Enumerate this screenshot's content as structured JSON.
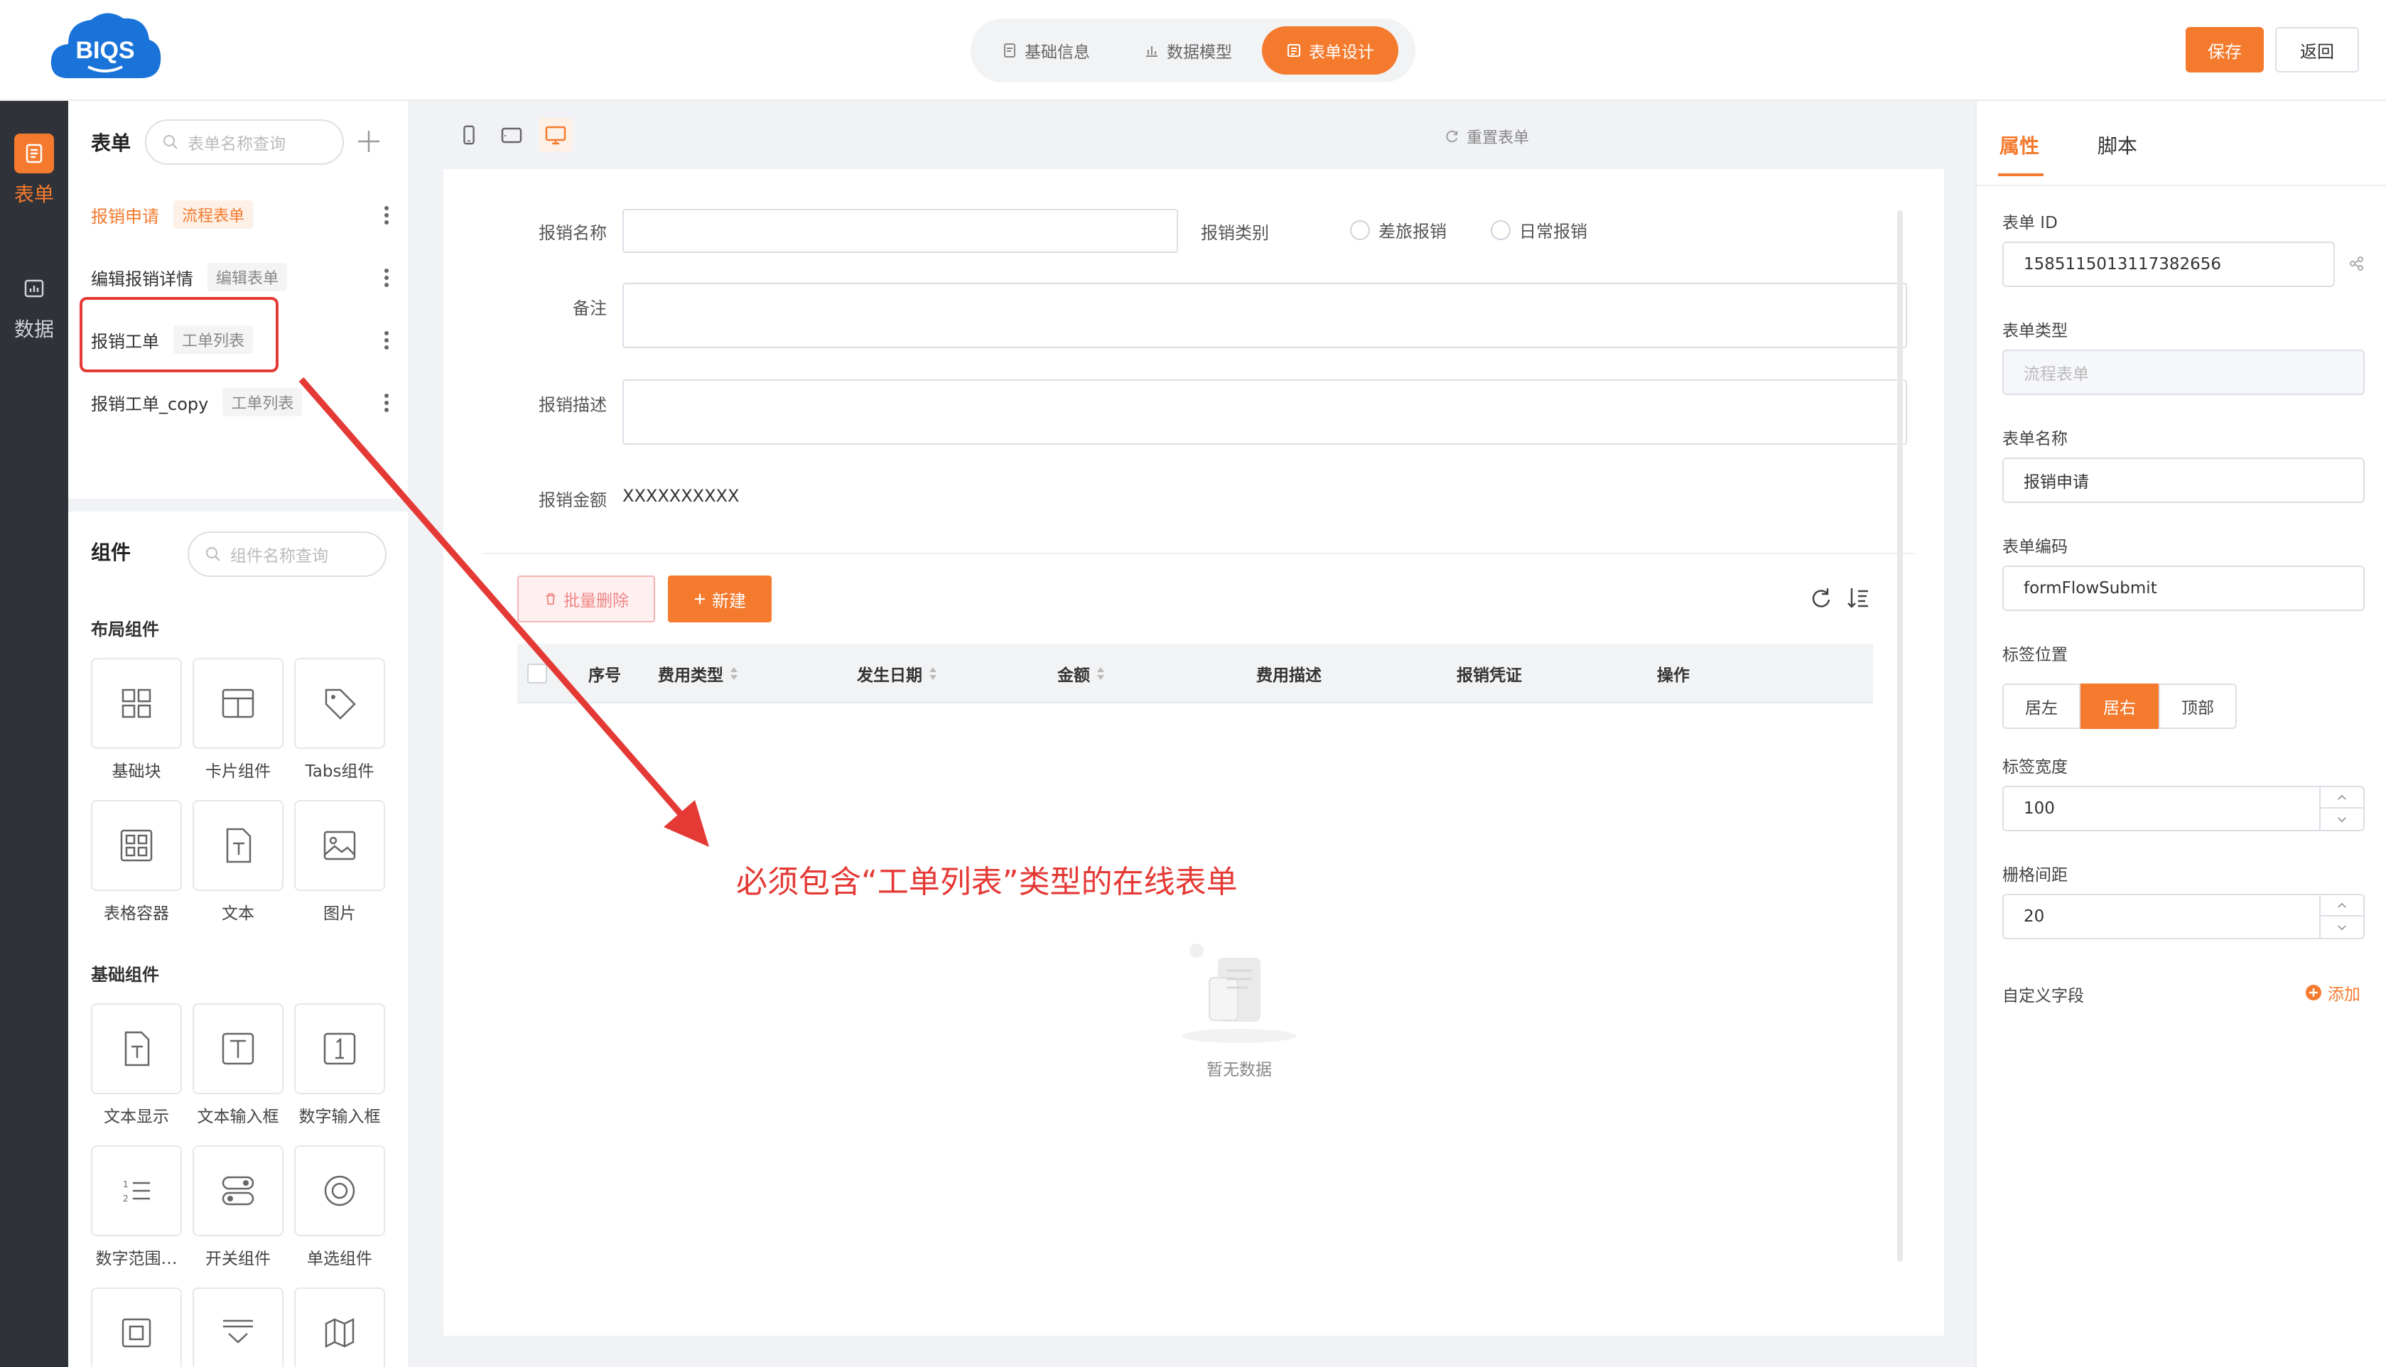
{
  "header": {
    "logo_text": "BIQS",
    "steps": [
      {
        "label": "基础信息",
        "icon": "document-icon",
        "active": false
      },
      {
        "label": "数据模型",
        "icon": "bar-chart-icon",
        "active": false
      },
      {
        "label": "表单设计",
        "icon": "form-icon",
        "active": true
      }
    ],
    "save_label": "保存",
    "back_label": "返回",
    "accent": "#f47a2e"
  },
  "rail": {
    "items": [
      {
        "label": "表单",
        "icon": "form-list-icon",
        "active": true
      },
      {
        "label": "数据",
        "icon": "data-chart-icon",
        "active": false
      }
    ]
  },
  "forms": {
    "title": "表单",
    "search_placeholder": "表单名称查询",
    "items": [
      {
        "name": "报销申请",
        "tag": "流程表单",
        "active": true
      },
      {
        "name": "编辑报销详情",
        "tag": "编辑表单",
        "active": false
      },
      {
        "name": "报销工单",
        "tag": "工单列表",
        "active": false
      },
      {
        "name": "报销工单_copy",
        "tag": "工单列表",
        "active": false
      }
    ]
  },
  "components": {
    "title": "组件",
    "search_placeholder": "组件名称查询",
    "layout_title": "布局组件",
    "layout": [
      {
        "label": "基础块",
        "icon": "grid-icon"
      },
      {
        "label": "卡片组件",
        "icon": "card-icon"
      },
      {
        "label": "Tabs组件",
        "icon": "tag-icon"
      },
      {
        "label": "表格容器",
        "icon": "table-grid-icon"
      },
      {
        "label": "文本",
        "icon": "text-file-icon"
      },
      {
        "label": "图片",
        "icon": "image-icon"
      }
    ],
    "basic_title": "基础组件",
    "basic": [
      {
        "label": "文本显示",
        "icon": "text-display-icon"
      },
      {
        "label": "文本输入框",
        "icon": "text-input-icon"
      },
      {
        "label": "数字输入框",
        "icon": "number-input-icon"
      },
      {
        "label": "数字范围…",
        "icon": "number-range-icon"
      },
      {
        "label": "开关组件",
        "icon": "switch-icon"
      },
      {
        "label": "单选组件",
        "icon": "radio-icon"
      },
      {
        "label": "",
        "icon": "checkbox-icon"
      },
      {
        "label": "",
        "icon": "select-icon"
      },
      {
        "label": "",
        "icon": "map-icon"
      }
    ]
  },
  "canvas": {
    "reset_label": "重置表单",
    "fields": {
      "name_label": "报销名称",
      "type_label": "报销类别",
      "type_options": [
        "差旅报销",
        "日常报销"
      ],
      "note_label": "备注",
      "desc_label": "报销描述",
      "amount_label": "报销金额",
      "amount_value": "XXXXXXXXXX"
    },
    "table": {
      "batch_delete_label": "批量删除",
      "new_label": "新建",
      "columns": [
        "序号",
        "费用类型",
        "发生日期",
        "金额",
        "费用描述",
        "报销凭证",
        "操作"
      ],
      "empty_text": "暂无数据"
    },
    "annotation": "必须包含“工单列表”类型的在线表单"
  },
  "props": {
    "tabs": [
      "属性",
      "脚本"
    ],
    "form_id_label": "表单 ID",
    "form_id_value": "1585115013117382656",
    "form_type_label": "表单类型",
    "form_type_value": "流程表单",
    "form_name_label": "表单名称",
    "form_name_value": "报销申请",
    "form_code_label": "表单编码",
    "form_code_value": "formFlowSubmit",
    "label_pos_label": "标签位置",
    "label_pos_options": [
      "居左",
      "居右",
      "顶部"
    ],
    "label_pos_selected": "居右",
    "label_width_label": "标签宽度",
    "label_width_value": "100",
    "grid_gap_label": "栅格间距",
    "grid_gap_value": "20",
    "custom_field_label": "自定义字段",
    "add_label": "添加"
  }
}
